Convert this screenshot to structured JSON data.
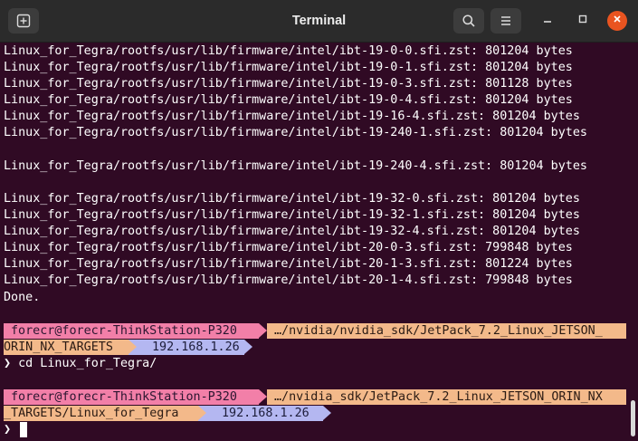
{
  "window": {
    "title": "Terminal"
  },
  "icons": {
    "new_tab": "new-tab-icon",
    "search": "search-icon",
    "menu": "hamburger-menu-icon",
    "minimize": "minimize-icon",
    "maximize": "maximize-icon",
    "close": "close-icon"
  },
  "colors": {
    "terminal_bg": "#300a24",
    "prompt_user": "#f27fa8",
    "prompt_path": "#f3b98a",
    "prompt_ip": "#b4b7f1",
    "close_button": "#e95420"
  },
  "output": [
    "Linux_for_Tegra/rootfs/usr/lib/firmware/intel/ibt-19-0-0.sfi.zst: 801204 bytes",
    "Linux_for_Tegra/rootfs/usr/lib/firmware/intel/ibt-19-0-1.sfi.zst: 801204 bytes",
    "Linux_for_Tegra/rootfs/usr/lib/firmware/intel/ibt-19-0-3.sfi.zst: 801128 bytes",
    "Linux_for_Tegra/rootfs/usr/lib/firmware/intel/ibt-19-0-4.sfi.zst: 801204 bytes",
    "Linux_for_Tegra/rootfs/usr/lib/firmware/intel/ibt-19-16-4.sfi.zst: 801204 bytes",
    "Linux_for_Tegra/rootfs/usr/lib/firmware/intel/ibt-19-240-1.sfi.zst: 801204 bytes",
    "",
    "Linux_for_Tegra/rootfs/usr/lib/firmware/intel/ibt-19-240-4.sfi.zst: 801204 bytes",
    "",
    "Linux_for_Tegra/rootfs/usr/lib/firmware/intel/ibt-19-32-0.sfi.zst: 801204 bytes",
    "Linux_for_Tegra/rootfs/usr/lib/firmware/intel/ibt-19-32-1.sfi.zst: 801204 bytes",
    "Linux_for_Tegra/rootfs/usr/lib/firmware/intel/ibt-19-32-4.sfi.zst: 801204 bytes",
    "Linux_for_Tegra/rootfs/usr/lib/firmware/intel/ibt-20-0-3.sfi.zst: 799848 bytes",
    "Linux_for_Tegra/rootfs/usr/lib/firmware/intel/ibt-20-1-3.sfi.zst: 801224 bytes",
    "Linux_for_Tegra/rootfs/usr/lib/firmware/intel/ibt-20-1-4.sfi.zst: 799848 bytes",
    "Done."
  ],
  "prompt1": {
    "user_host": "forecr@forecr-ThinkStation-P320",
    "path_line1": "…/nvidia/nvidia_sdk/JetPack_7.2_Linux_JETSON_",
    "path_line2": "ORIN_NX_TARGETS",
    "ip": "192.168.1.26",
    "command_line": "❯ cd Linux_for_Tegra/"
  },
  "prompt2": {
    "user_host": "forecr@forecr-ThinkStation-P320",
    "path_line1": "…/nvidia_sdk/JetPack_7.2_Linux_JETSON_ORIN_NX",
    "path_line2": "_TARGETS/Linux_for_Tegra",
    "ip": "192.168.1.26",
    "command_line": "❯"
  }
}
